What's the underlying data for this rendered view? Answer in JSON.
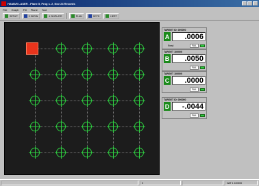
{
  "window": {
    "title": "HAMAR LASER - Plane 5, Prog s. 2, Nov 24 Records"
  },
  "menu": [
    "File",
    "Graph",
    "Fill",
    "Plane",
    "Tool"
  ],
  "toolbar": [
    {
      "label": "SETUP",
      "icon": "setup-icon"
    },
    {
      "label": "3 SKRIN",
      "icon": "screen-icon"
    },
    {
      "label": "4 SKIPLATE",
      "icon": "plate-icon"
    },
    {
      "label": "PLAN",
      "icon": "plan-icon"
    },
    {
      "label": "SCTS",
      "icon": "scts-icon"
    },
    {
      "label": "HERT",
      "icon": "hert-icon"
    }
  ],
  "grid": {
    "rows": 5,
    "cols": 5,
    "laser_position": {
      "row": 0,
      "col": 0
    }
  },
  "axes": [
    {
      "title": "TARGET ID: 000000",
      "letter": "A",
      "value": ".0006",
      "foot_label": "Read",
      "fail": "FAIL"
    },
    {
      "title": "TARGET 100000",
      "letter": "B",
      "value": ".0050",
      "foot_label": "",
      "fail": "FAIL"
    },
    {
      "title": "TARGET 100000",
      "letter": "C",
      "value": ".0000",
      "foot_label": "",
      "fail": "FAIL"
    },
    {
      "title": "TARGET ID: 000000",
      "letter": "D",
      "value": "-.0044",
      "foot_label": "",
      "fail": "FAIL"
    }
  ],
  "status": {
    "left": "",
    "middle": "0",
    "right": "NAT 1 100000"
  },
  "colors": {
    "accent_green": "#1a8a1a",
    "laser_red": "#e8341c",
    "canvas_bg": "#1c1c1c",
    "target_green": "#2ecc40"
  }
}
